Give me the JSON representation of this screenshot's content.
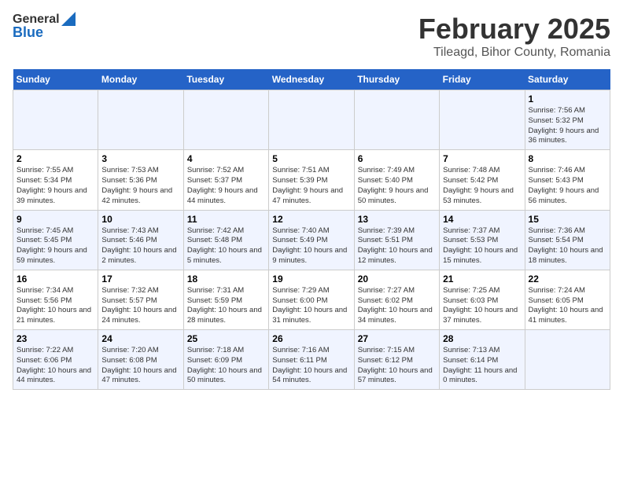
{
  "header": {
    "logo_line1": "General",
    "logo_line2": "Blue",
    "title": "February 2025",
    "subtitle": "Tileagd, Bihor County, Romania"
  },
  "calendar": {
    "days_of_week": [
      "Sunday",
      "Monday",
      "Tuesday",
      "Wednesday",
      "Thursday",
      "Friday",
      "Saturday"
    ],
    "weeks": [
      [
        {
          "day": "",
          "info": ""
        },
        {
          "day": "",
          "info": ""
        },
        {
          "day": "",
          "info": ""
        },
        {
          "day": "",
          "info": ""
        },
        {
          "day": "",
          "info": ""
        },
        {
          "day": "",
          "info": ""
        },
        {
          "day": "1",
          "info": "Sunrise: 7:56 AM\nSunset: 5:32 PM\nDaylight: 9 hours and 36 minutes."
        }
      ],
      [
        {
          "day": "2",
          "info": "Sunrise: 7:55 AM\nSunset: 5:34 PM\nDaylight: 9 hours and 39 minutes."
        },
        {
          "day": "3",
          "info": "Sunrise: 7:53 AM\nSunset: 5:36 PM\nDaylight: 9 hours and 42 minutes."
        },
        {
          "day": "4",
          "info": "Sunrise: 7:52 AM\nSunset: 5:37 PM\nDaylight: 9 hours and 44 minutes."
        },
        {
          "day": "5",
          "info": "Sunrise: 7:51 AM\nSunset: 5:39 PM\nDaylight: 9 hours and 47 minutes."
        },
        {
          "day": "6",
          "info": "Sunrise: 7:49 AM\nSunset: 5:40 PM\nDaylight: 9 hours and 50 minutes."
        },
        {
          "day": "7",
          "info": "Sunrise: 7:48 AM\nSunset: 5:42 PM\nDaylight: 9 hours and 53 minutes."
        },
        {
          "day": "8",
          "info": "Sunrise: 7:46 AM\nSunset: 5:43 PM\nDaylight: 9 hours and 56 minutes."
        }
      ],
      [
        {
          "day": "9",
          "info": "Sunrise: 7:45 AM\nSunset: 5:45 PM\nDaylight: 9 hours and 59 minutes."
        },
        {
          "day": "10",
          "info": "Sunrise: 7:43 AM\nSunset: 5:46 PM\nDaylight: 10 hours and 2 minutes."
        },
        {
          "day": "11",
          "info": "Sunrise: 7:42 AM\nSunset: 5:48 PM\nDaylight: 10 hours and 5 minutes."
        },
        {
          "day": "12",
          "info": "Sunrise: 7:40 AM\nSunset: 5:49 PM\nDaylight: 10 hours and 9 minutes."
        },
        {
          "day": "13",
          "info": "Sunrise: 7:39 AM\nSunset: 5:51 PM\nDaylight: 10 hours and 12 minutes."
        },
        {
          "day": "14",
          "info": "Sunrise: 7:37 AM\nSunset: 5:53 PM\nDaylight: 10 hours and 15 minutes."
        },
        {
          "day": "15",
          "info": "Sunrise: 7:36 AM\nSunset: 5:54 PM\nDaylight: 10 hours and 18 minutes."
        }
      ],
      [
        {
          "day": "16",
          "info": "Sunrise: 7:34 AM\nSunset: 5:56 PM\nDaylight: 10 hours and 21 minutes."
        },
        {
          "day": "17",
          "info": "Sunrise: 7:32 AM\nSunset: 5:57 PM\nDaylight: 10 hours and 24 minutes."
        },
        {
          "day": "18",
          "info": "Sunrise: 7:31 AM\nSunset: 5:59 PM\nDaylight: 10 hours and 28 minutes."
        },
        {
          "day": "19",
          "info": "Sunrise: 7:29 AM\nSunset: 6:00 PM\nDaylight: 10 hours and 31 minutes."
        },
        {
          "day": "20",
          "info": "Sunrise: 7:27 AM\nSunset: 6:02 PM\nDaylight: 10 hours and 34 minutes."
        },
        {
          "day": "21",
          "info": "Sunrise: 7:25 AM\nSunset: 6:03 PM\nDaylight: 10 hours and 37 minutes."
        },
        {
          "day": "22",
          "info": "Sunrise: 7:24 AM\nSunset: 6:05 PM\nDaylight: 10 hours and 41 minutes."
        }
      ],
      [
        {
          "day": "23",
          "info": "Sunrise: 7:22 AM\nSunset: 6:06 PM\nDaylight: 10 hours and 44 minutes."
        },
        {
          "day": "24",
          "info": "Sunrise: 7:20 AM\nSunset: 6:08 PM\nDaylight: 10 hours and 47 minutes."
        },
        {
          "day": "25",
          "info": "Sunrise: 7:18 AM\nSunset: 6:09 PM\nDaylight: 10 hours and 50 minutes."
        },
        {
          "day": "26",
          "info": "Sunrise: 7:16 AM\nSunset: 6:11 PM\nDaylight: 10 hours and 54 minutes."
        },
        {
          "day": "27",
          "info": "Sunrise: 7:15 AM\nSunset: 6:12 PM\nDaylight: 10 hours and 57 minutes."
        },
        {
          "day": "28",
          "info": "Sunrise: 7:13 AM\nSunset: 6:14 PM\nDaylight: 11 hours and 0 minutes."
        },
        {
          "day": "",
          "info": ""
        }
      ]
    ]
  }
}
